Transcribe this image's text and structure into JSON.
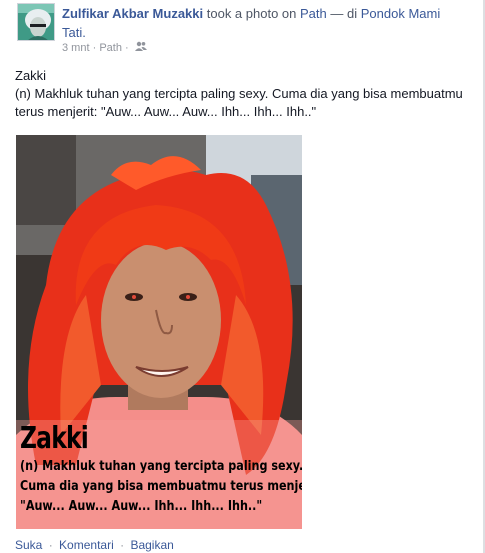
{
  "post": {
    "author": "Zulfikar Akbar Muzakki",
    "verb": "took a photo on",
    "app": "Path",
    "place_prefix": "— di",
    "place": "Pondok Mami Tati.",
    "time": "3 mnt",
    "via": "Path",
    "privacy_icon": "friends-icon",
    "text_line1": "Zakki",
    "text_line2": "(n) Makhluk tuhan yang tercipta paling sexy. Cuma dia yang bisa membuatmu terus menjerit: \"Auw... Auw... Auw... Ihh... Ihh... Ihh..\""
  },
  "photo": {
    "caption_title": "Zakki",
    "caption_line1": "(n) Makhluk tuhan yang tercipta paling sexy.",
    "caption_line2": "Cuma dia yang bisa membuatmu terus menjerit",
    "caption_line3": "\"Auw... Auw... Auw... Ihh... Ihh... Ihh..\""
  },
  "actions": {
    "like": "Suka",
    "comment": "Komentari",
    "share": "Bagikan",
    "separator": "·"
  },
  "colors": {
    "link": "#3b5998",
    "muted": "#90949c",
    "wig": "#f03a16",
    "shirt": "#f48e8a"
  }
}
